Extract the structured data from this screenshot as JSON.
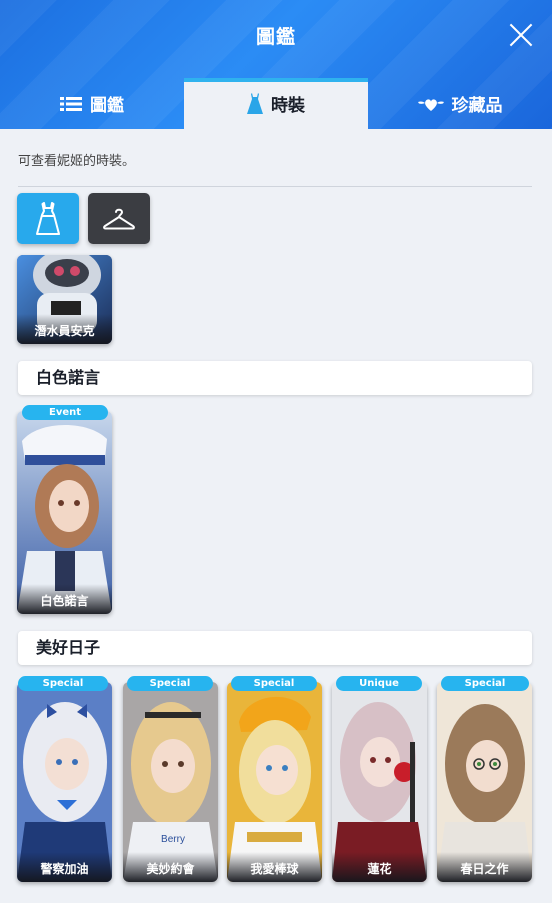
{
  "window": {
    "title": "圖鑑"
  },
  "tabs": [
    {
      "label": "圖鑑",
      "icon": "list-icon"
    },
    {
      "label": "時裝",
      "icon": "dress-icon",
      "active": true
    },
    {
      "label": "珍藏品",
      "icon": "heart-wings-icon"
    }
  ],
  "description": "可查看妮姬的時裝。",
  "filters": [
    {
      "icon": "dress-icon",
      "selected": true
    },
    {
      "icon": "hanger-icon",
      "selected": false
    }
  ],
  "sections": [
    {
      "title": "",
      "cards": [
        {
          "name": "潛水員安克",
          "badge": ""
        }
      ]
    },
    {
      "title": "白色諾言",
      "cards": [
        {
          "name": "白色諾言",
          "badge": "Event"
        }
      ]
    },
    {
      "title": "美好日子",
      "cards": [
        {
          "name": "警察加油",
          "badge": "Special"
        },
        {
          "name": "美妙約會",
          "badge": "Special"
        },
        {
          "name": "我愛棒球",
          "badge": "Special"
        },
        {
          "name": "蓮花",
          "badge": "Unique"
        },
        {
          "name": "春日之作",
          "badge": "Special"
        }
      ]
    }
  ],
  "colors": {
    "header_blue": "#1c6fe0",
    "accent_cyan": "#28a9ec",
    "badge_cyan": "#27b4ef",
    "background": "#eef1f6"
  }
}
